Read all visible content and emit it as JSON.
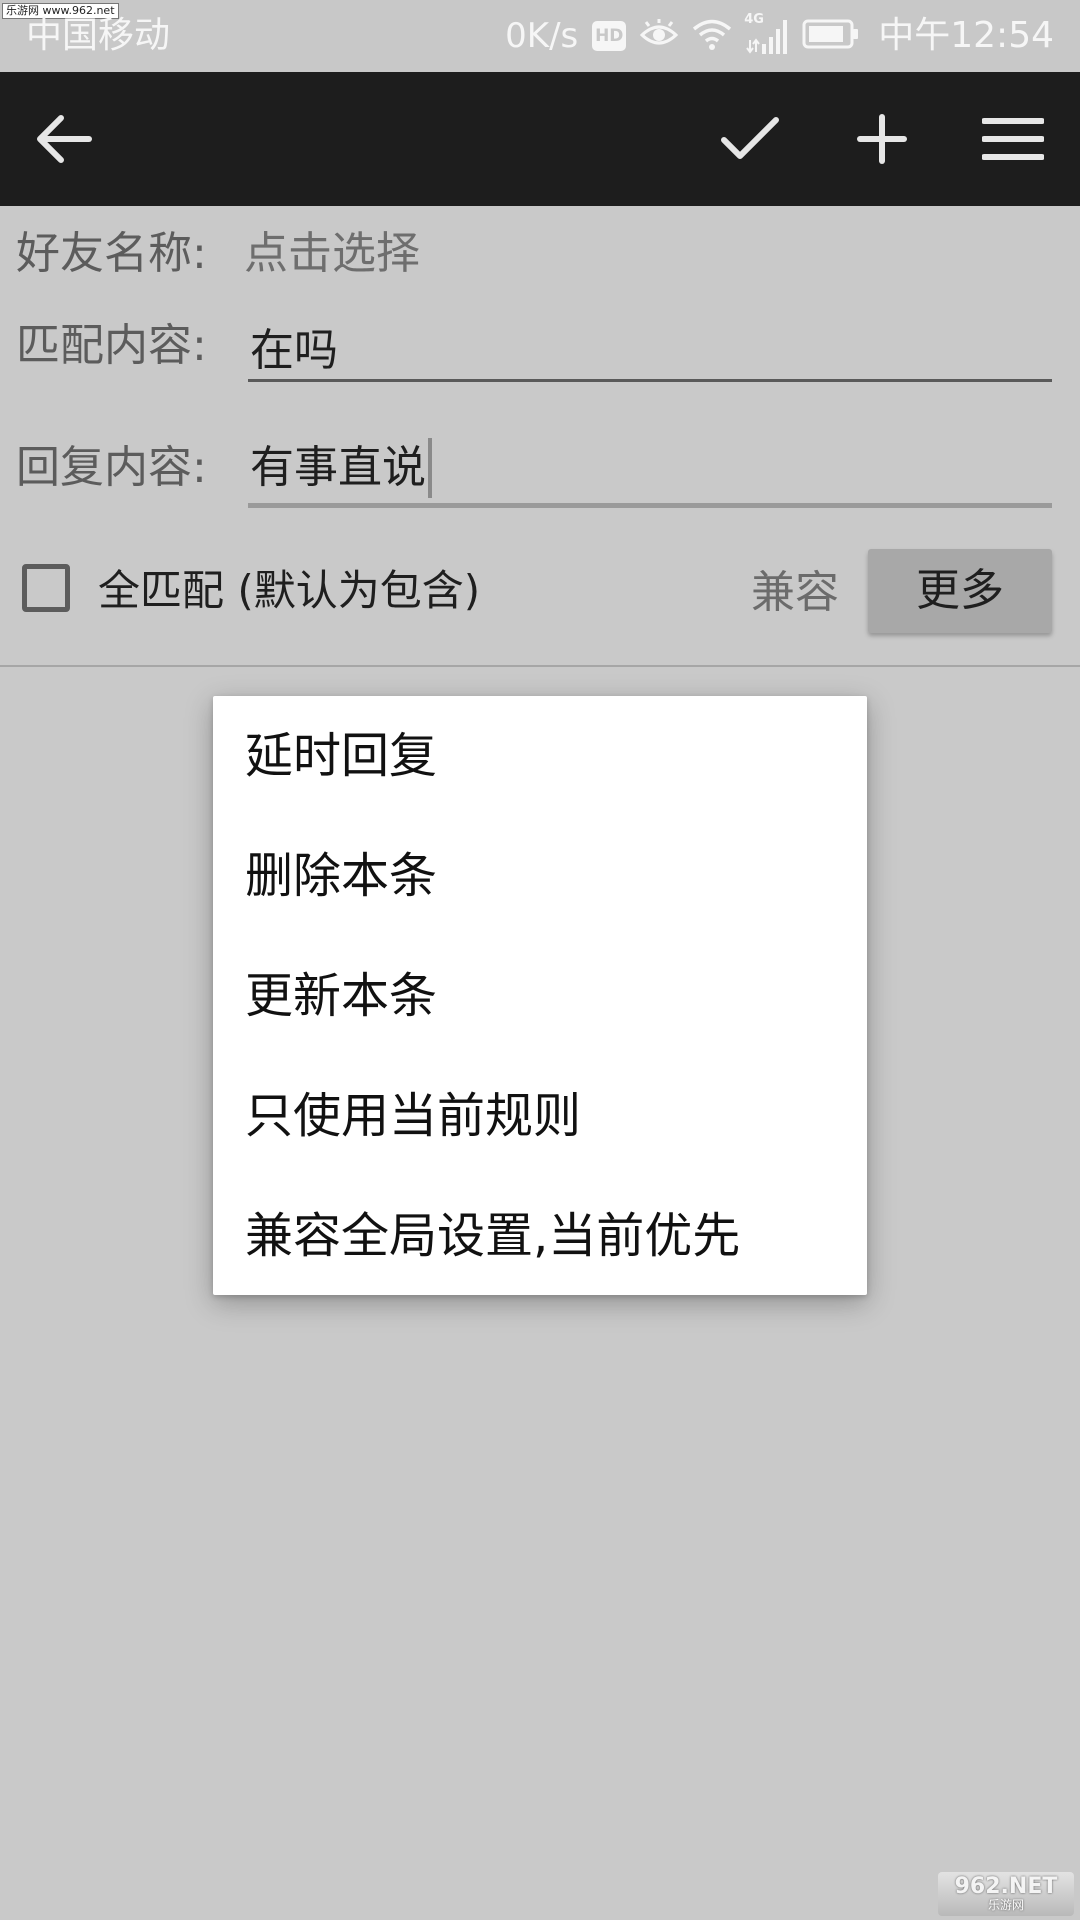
{
  "watermark_top": "乐游网 www.962.net",
  "status_bar": {
    "carrier": "中国移动",
    "net_speed": "0K/s",
    "hd_badge": "HD",
    "network_type": "4G",
    "time": "中午12:54",
    "icons": [
      "hd-icon",
      "eye-icon",
      "wifi-icon",
      "signal-icon",
      "battery-icon"
    ]
  },
  "toolbar": {
    "icons": [
      "back-arrow-icon",
      "check-icon",
      "plus-icon",
      "menu-icon"
    ]
  },
  "form": {
    "friend_name_label": "好友名称:",
    "friend_name_value": "点击选择",
    "match_label": "匹配内容:",
    "match_value": "在吗",
    "reply_label": "回复内容:",
    "reply_value": "有事直说",
    "full_match_label": "全匹配 (默认为包含)",
    "full_match_checked": false,
    "compat_label": "兼容",
    "more_label": "更多"
  },
  "popup_menu": {
    "items": [
      "延时回复",
      "删除本条",
      "更新本条",
      "只使用当前规则",
      "兼容全局设置,当前优先"
    ]
  },
  "watermark_bottom": {
    "main": "962.NET",
    "sub": "乐游网"
  },
  "colors": {
    "background": "#c9c9c9",
    "toolbar": "#1d1d1d",
    "more_button": "#a8a8a8",
    "popup": "#ffffff"
  }
}
